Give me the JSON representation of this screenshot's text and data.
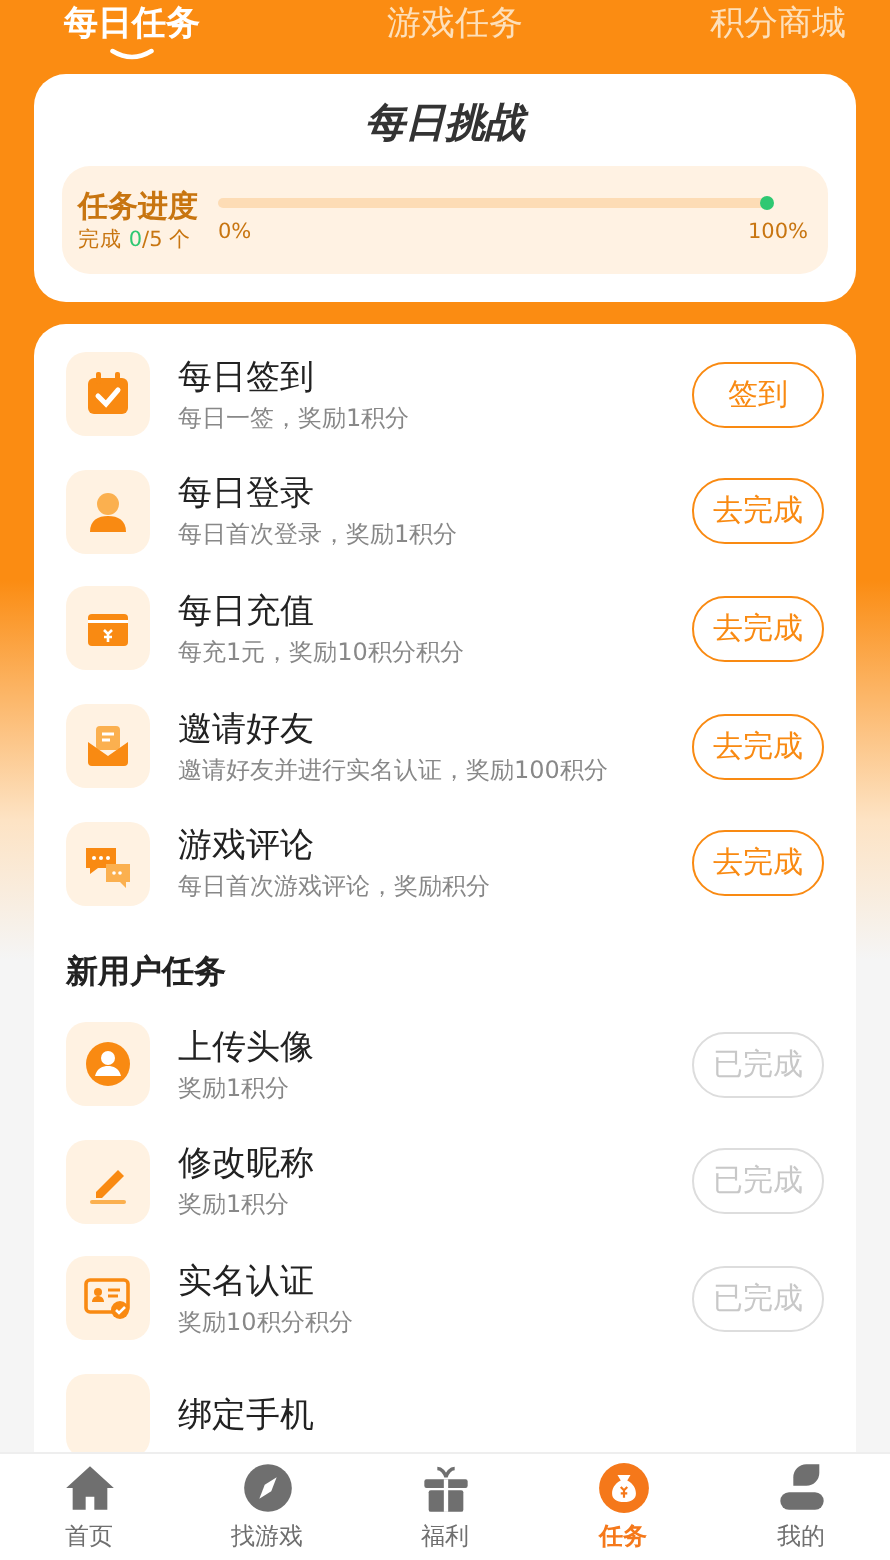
{
  "top_tabs": [
    {
      "label": "每日任务",
      "selected": true
    },
    {
      "label": "游戏任务",
      "selected": false
    },
    {
      "label": "积分商城",
      "selected": false
    }
  ],
  "challenge": {
    "title": "每日挑战",
    "progress_label": "任务进度",
    "done_prefix": "完成",
    "done_count": "0",
    "done_suffix": "/5 个",
    "level": 0,
    "start_label": "0%",
    "end_label": "100%"
  },
  "daily_tasks": [
    {
      "title": "每日签到",
      "desc": "每日一签，奖励1积分",
      "button": "签到",
      "done": false
    },
    {
      "title": "每日登录",
      "desc": "每日首次登录，奖励1积分",
      "button": "去完成",
      "done": false
    },
    {
      "title": "每日充值",
      "desc": "每充1元，奖励10积分积分",
      "button": "去完成",
      "done": false
    },
    {
      "title": "邀请好友",
      "desc": "邀请好友并进行实名认证，奖励100积分",
      "button": "去完成",
      "done": false
    },
    {
      "title": "游戏评论",
      "desc": "每日首次游戏评论，奖励积分",
      "button": "去完成",
      "done": false
    }
  ],
  "new_user_section": {
    "title": "新用户任务",
    "tasks": [
      {
        "title": "上传头像",
        "desc": "奖励1积分",
        "button": "已完成",
        "done": true
      },
      {
        "title": "修改昵称",
        "desc": "奖励1积分",
        "button": "已完成",
        "done": true
      },
      {
        "title": "实名认证",
        "desc": "奖励10积分积分",
        "button": "已完成",
        "done": true
      },
      {
        "title": "绑定手机"
      }
    ]
  },
  "bottom_nav": [
    {
      "label": "首页",
      "selected": false
    },
    {
      "label": "找游戏",
      "selected": false
    },
    {
      "label": "福利",
      "selected": false
    },
    {
      "label": "任务",
      "selected": true
    },
    {
      "label": "我的",
      "selected": false
    }
  ]
}
